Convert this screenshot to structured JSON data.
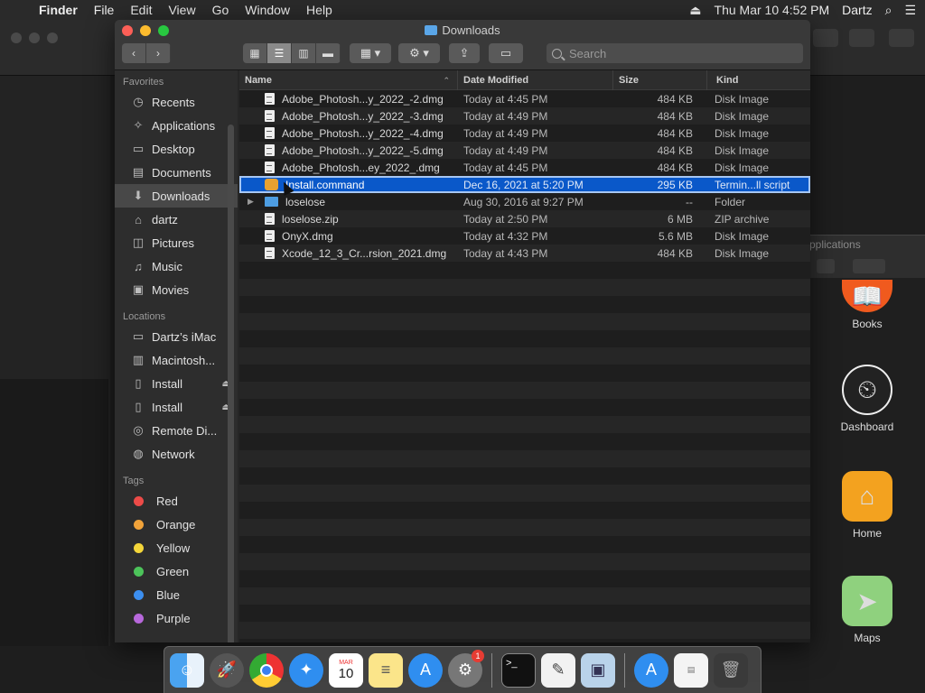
{
  "menubar": {
    "app": "Finder",
    "items": [
      "File",
      "Edit",
      "View",
      "Go",
      "Window",
      "Help"
    ],
    "datetime": "Thu Mar 10  4:52 PM",
    "user": "Dartz"
  },
  "window": {
    "title": "Downloads",
    "search_placeholder": "Search"
  },
  "sidebar": {
    "favorites_title": "Favorites",
    "favorites": [
      {
        "label": "Recents",
        "icon": "clock-icon"
      },
      {
        "label": "Applications",
        "icon": "applications-icon"
      },
      {
        "label": "Desktop",
        "icon": "desktop-icon"
      },
      {
        "label": "Documents",
        "icon": "documents-icon"
      },
      {
        "label": "Downloads",
        "icon": "downloads-icon"
      },
      {
        "label": "dartz",
        "icon": "home-icon"
      },
      {
        "label": "Pictures",
        "icon": "pictures-icon"
      },
      {
        "label": "Music",
        "icon": "music-icon"
      },
      {
        "label": "Movies",
        "icon": "movies-icon"
      }
    ],
    "locations_title": "Locations",
    "locations": [
      {
        "label": "Dartz’s iMac",
        "icon": "imac-icon"
      },
      {
        "label": "Macintosh...",
        "icon": "disk-icon"
      },
      {
        "label": "Install",
        "icon": "disk-icon"
      },
      {
        "label": "Install",
        "icon": "disk-icon"
      },
      {
        "label": "Remote Di...",
        "icon": "remote-disc-icon"
      },
      {
        "label": "Network",
        "icon": "network-icon"
      }
    ],
    "tags_title": "Tags",
    "tags": [
      {
        "label": "Red",
        "color": "#ec4b48"
      },
      {
        "label": "Orange",
        "color": "#f1a33a"
      },
      {
        "label": "Yellow",
        "color": "#f4d63a"
      },
      {
        "label": "Green",
        "color": "#4cc35a"
      },
      {
        "label": "Blue",
        "color": "#3c8ff0"
      },
      {
        "label": "Purple",
        "color": "#b768db"
      }
    ]
  },
  "columns": {
    "name": "Name",
    "date": "Date Modified",
    "size": "Size",
    "kind": "Kind"
  },
  "files": [
    {
      "name": "Adobe_Photosh...y_2022_-2.dmg",
      "date": "Today at 4:45 PM",
      "size": "484 KB",
      "kind": "Disk Image",
      "type": "file"
    },
    {
      "name": "Adobe_Photosh...y_2022_-3.dmg",
      "date": "Today at 4:49 PM",
      "size": "484 KB",
      "kind": "Disk Image",
      "type": "file"
    },
    {
      "name": "Adobe_Photosh...y_2022_-4.dmg",
      "date": "Today at 4:49 PM",
      "size": "484 KB",
      "kind": "Disk Image",
      "type": "file"
    },
    {
      "name": "Adobe_Photosh...y_2022_-5.dmg",
      "date": "Today at 4:49 PM",
      "size": "484 KB",
      "kind": "Disk Image",
      "type": "file"
    },
    {
      "name": "Adobe_Photosh...ey_2022_.dmg",
      "date": "Today at 4:45 PM",
      "size": "484 KB",
      "kind": "Disk Image",
      "type": "file"
    },
    {
      "name": "Install.command",
      "date": "Dec 16, 2021 at 5:20 PM",
      "size": "295 KB",
      "kind": "Termin...ll script",
      "type": "cmd",
      "selected": true
    },
    {
      "name": "loselose",
      "date": "Aug 30, 2016 at 9:27 PM",
      "size": "--",
      "kind": "Folder",
      "type": "folder"
    },
    {
      "name": "loselose.zip",
      "date": "Today at 2:50 PM",
      "size": "6 MB",
      "kind": "ZIP archive",
      "type": "file"
    },
    {
      "name": "OnyX.dmg",
      "date": "Today at 4:32 PM",
      "size": "5.6 MB",
      "kind": "Disk Image",
      "type": "file"
    },
    {
      "name": "Xcode_12_3_Cr...rsion_2021.dmg",
      "date": "Today at 4:43 PM",
      "size": "484 KB",
      "kind": "Disk Image",
      "type": "file"
    }
  ],
  "side_apps": {
    "window_title": "pplications",
    "items": [
      {
        "label": "Books",
        "icon": "books-icon"
      },
      {
        "label": "Dashboard",
        "icon": "dashboard-icon"
      },
      {
        "label": "Home",
        "icon": "home-app-icon"
      },
      {
        "label": "Maps",
        "icon": "maps-icon"
      }
    ]
  },
  "dock": {
    "calendar_month": "MAR",
    "calendar_day": "10",
    "badge": "1",
    "items": [
      "finder-icon",
      "launchpad-icon",
      "chrome-icon",
      "safari-icon",
      "calendar-icon",
      "notes-icon",
      "app-store-icon",
      "system-preferences-icon",
      "terminal-icon",
      "textedit-icon",
      "preview-icon",
      "app-store-icon",
      "spell-doc-icon",
      "trash-icon"
    ]
  }
}
